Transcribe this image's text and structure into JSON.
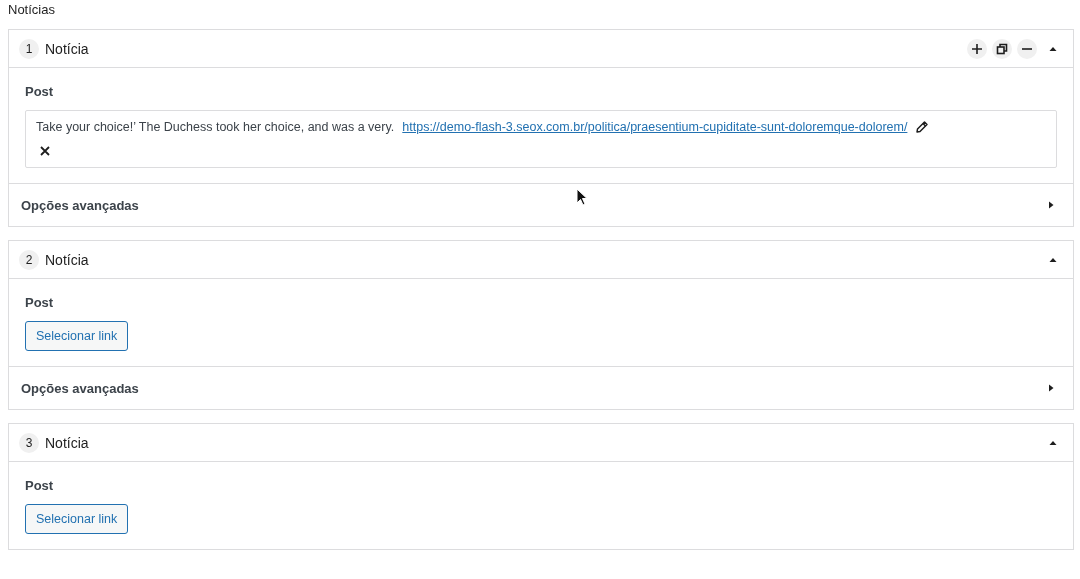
{
  "section_title": "Notícias",
  "items": [
    {
      "number": "1",
      "title": "Notícia",
      "expanded": true,
      "actions_visible": true,
      "post_label": "Post",
      "post": {
        "kind": "selected",
        "text": "Take your choice!’ The Duchess took her choice, and was a very.",
        "url": "https://demo-flash-3.seox.com.br/politica/praesentium-cupiditate-sunt-doloremque-dolorem/"
      },
      "advanced": {
        "label": "Opções avançadas",
        "expanded": false
      }
    },
    {
      "number": "2",
      "title": "Notícia",
      "expanded": true,
      "actions_visible": false,
      "post_label": "Post",
      "post": {
        "kind": "empty",
        "button": "Selecionar link"
      },
      "advanced": {
        "label": "Opções avançadas",
        "expanded": false
      }
    },
    {
      "number": "3",
      "title": "Notícia",
      "expanded": true,
      "actions_visible": false,
      "post_label": "Post",
      "post": {
        "kind": "empty",
        "button": "Selecionar link"
      }
    }
  ]
}
